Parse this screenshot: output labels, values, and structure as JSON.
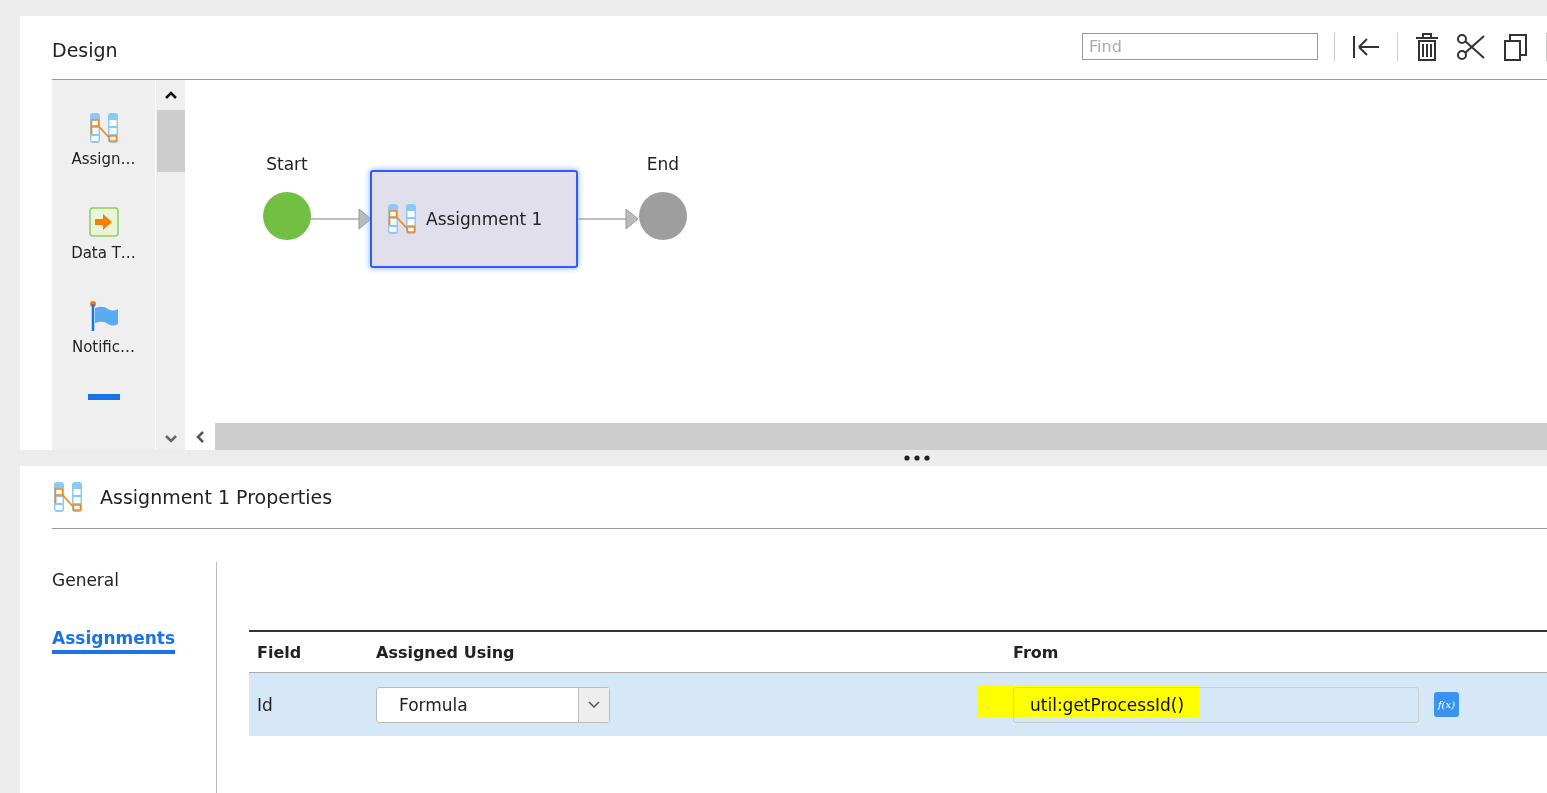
{
  "design": {
    "title": "Design",
    "find": {
      "placeholder": "Find"
    }
  },
  "palette": [
    {
      "label": "Assign…",
      "kind": "assignment"
    },
    {
      "label": "Data T…",
      "kind": "data"
    },
    {
      "label": "Notific…",
      "kind": "notification"
    }
  ],
  "diagram": {
    "nodes": [
      {
        "kind": "start",
        "label": "Start"
      },
      {
        "kind": "task",
        "label": "Assignment 1",
        "selected": true
      },
      {
        "kind": "end",
        "label": "End"
      }
    ]
  },
  "properties": {
    "title": "Assignment 1 Properties",
    "tabs": [
      {
        "label": "General",
        "selected": false
      },
      {
        "label": "Assignments",
        "selected": true
      }
    ],
    "table": {
      "columns": [
        "Field",
        "Assigned Using",
        "From"
      ],
      "rows": [
        {
          "field": "Id",
          "assigned_using": "Formula",
          "from": "util:getProcessId()",
          "highlighted": true,
          "selected": true,
          "formula_button": "f(x)"
        }
      ]
    }
  }
}
